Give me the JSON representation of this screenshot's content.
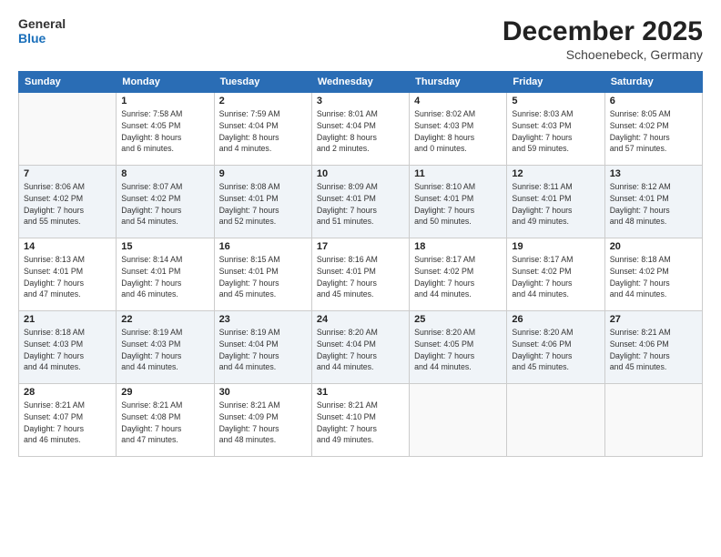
{
  "logo": {
    "line1": "General",
    "line2": "Blue"
  },
  "title": "December 2025",
  "location": "Schoenebeck, Germany",
  "days_of_week": [
    "Sunday",
    "Monday",
    "Tuesday",
    "Wednesday",
    "Thursday",
    "Friday",
    "Saturday"
  ],
  "weeks": [
    [
      {
        "day": "",
        "info": ""
      },
      {
        "day": "1",
        "info": "Sunrise: 7:58 AM\nSunset: 4:05 PM\nDaylight: 8 hours\nand 6 minutes."
      },
      {
        "day": "2",
        "info": "Sunrise: 7:59 AM\nSunset: 4:04 PM\nDaylight: 8 hours\nand 4 minutes."
      },
      {
        "day": "3",
        "info": "Sunrise: 8:01 AM\nSunset: 4:04 PM\nDaylight: 8 hours\nand 2 minutes."
      },
      {
        "day": "4",
        "info": "Sunrise: 8:02 AM\nSunset: 4:03 PM\nDaylight: 8 hours\nand 0 minutes."
      },
      {
        "day": "5",
        "info": "Sunrise: 8:03 AM\nSunset: 4:03 PM\nDaylight: 7 hours\nand 59 minutes."
      },
      {
        "day": "6",
        "info": "Sunrise: 8:05 AM\nSunset: 4:02 PM\nDaylight: 7 hours\nand 57 minutes."
      }
    ],
    [
      {
        "day": "7",
        "info": "Sunrise: 8:06 AM\nSunset: 4:02 PM\nDaylight: 7 hours\nand 55 minutes."
      },
      {
        "day": "8",
        "info": "Sunrise: 8:07 AM\nSunset: 4:02 PM\nDaylight: 7 hours\nand 54 minutes."
      },
      {
        "day": "9",
        "info": "Sunrise: 8:08 AM\nSunset: 4:01 PM\nDaylight: 7 hours\nand 52 minutes."
      },
      {
        "day": "10",
        "info": "Sunrise: 8:09 AM\nSunset: 4:01 PM\nDaylight: 7 hours\nand 51 minutes."
      },
      {
        "day": "11",
        "info": "Sunrise: 8:10 AM\nSunset: 4:01 PM\nDaylight: 7 hours\nand 50 minutes."
      },
      {
        "day": "12",
        "info": "Sunrise: 8:11 AM\nSunset: 4:01 PM\nDaylight: 7 hours\nand 49 minutes."
      },
      {
        "day": "13",
        "info": "Sunrise: 8:12 AM\nSunset: 4:01 PM\nDaylight: 7 hours\nand 48 minutes."
      }
    ],
    [
      {
        "day": "14",
        "info": "Sunrise: 8:13 AM\nSunset: 4:01 PM\nDaylight: 7 hours\nand 47 minutes."
      },
      {
        "day": "15",
        "info": "Sunrise: 8:14 AM\nSunset: 4:01 PM\nDaylight: 7 hours\nand 46 minutes."
      },
      {
        "day": "16",
        "info": "Sunrise: 8:15 AM\nSunset: 4:01 PM\nDaylight: 7 hours\nand 45 minutes."
      },
      {
        "day": "17",
        "info": "Sunrise: 8:16 AM\nSunset: 4:01 PM\nDaylight: 7 hours\nand 45 minutes."
      },
      {
        "day": "18",
        "info": "Sunrise: 8:17 AM\nSunset: 4:02 PM\nDaylight: 7 hours\nand 44 minutes."
      },
      {
        "day": "19",
        "info": "Sunrise: 8:17 AM\nSunset: 4:02 PM\nDaylight: 7 hours\nand 44 minutes."
      },
      {
        "day": "20",
        "info": "Sunrise: 8:18 AM\nSunset: 4:02 PM\nDaylight: 7 hours\nand 44 minutes."
      }
    ],
    [
      {
        "day": "21",
        "info": "Sunrise: 8:18 AM\nSunset: 4:03 PM\nDaylight: 7 hours\nand 44 minutes."
      },
      {
        "day": "22",
        "info": "Sunrise: 8:19 AM\nSunset: 4:03 PM\nDaylight: 7 hours\nand 44 minutes."
      },
      {
        "day": "23",
        "info": "Sunrise: 8:19 AM\nSunset: 4:04 PM\nDaylight: 7 hours\nand 44 minutes."
      },
      {
        "day": "24",
        "info": "Sunrise: 8:20 AM\nSunset: 4:04 PM\nDaylight: 7 hours\nand 44 minutes."
      },
      {
        "day": "25",
        "info": "Sunrise: 8:20 AM\nSunset: 4:05 PM\nDaylight: 7 hours\nand 44 minutes."
      },
      {
        "day": "26",
        "info": "Sunrise: 8:20 AM\nSunset: 4:06 PM\nDaylight: 7 hours\nand 45 minutes."
      },
      {
        "day": "27",
        "info": "Sunrise: 8:21 AM\nSunset: 4:06 PM\nDaylight: 7 hours\nand 45 minutes."
      }
    ],
    [
      {
        "day": "28",
        "info": "Sunrise: 8:21 AM\nSunset: 4:07 PM\nDaylight: 7 hours\nand 46 minutes."
      },
      {
        "day": "29",
        "info": "Sunrise: 8:21 AM\nSunset: 4:08 PM\nDaylight: 7 hours\nand 47 minutes."
      },
      {
        "day": "30",
        "info": "Sunrise: 8:21 AM\nSunset: 4:09 PM\nDaylight: 7 hours\nand 48 minutes."
      },
      {
        "day": "31",
        "info": "Sunrise: 8:21 AM\nSunset: 4:10 PM\nDaylight: 7 hours\nand 49 minutes."
      },
      {
        "day": "",
        "info": ""
      },
      {
        "day": "",
        "info": ""
      },
      {
        "day": "",
        "info": ""
      }
    ]
  ]
}
